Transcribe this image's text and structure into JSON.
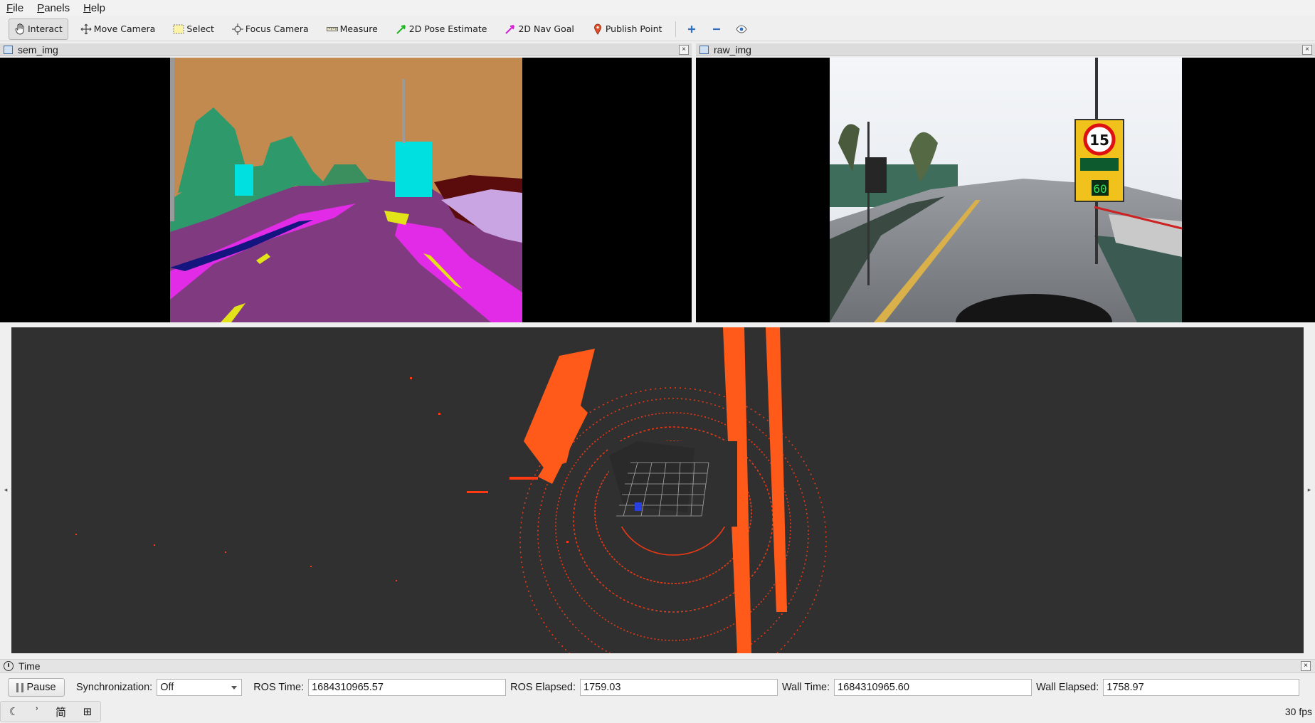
{
  "menubar": {
    "items": [
      {
        "label": "File",
        "mnemonic": "F",
        "rest": "ile"
      },
      {
        "label": "Panels",
        "mnemonic": "P",
        "rest": "anels"
      },
      {
        "label": "Help",
        "mnemonic": "H",
        "rest": "elp"
      }
    ]
  },
  "toolbar": {
    "tools": [
      {
        "label": "Interact",
        "icon": "hand-cursor-icon",
        "active": true
      },
      {
        "label": "Move Camera",
        "icon": "move-camera-icon"
      },
      {
        "label": "Select",
        "icon": "select-box-icon"
      },
      {
        "label": "Focus Camera",
        "icon": "focus-camera-icon"
      },
      {
        "label": "Measure",
        "icon": "ruler-icon"
      },
      {
        "label": "2D Pose Estimate",
        "icon": "green-arrow-icon"
      },
      {
        "label": "2D Nav Goal",
        "icon": "magenta-arrow-icon"
      },
      {
        "label": "Publish Point",
        "icon": "map-pin-icon"
      }
    ],
    "extra_icons": [
      "plus-icon",
      "minus-icon",
      "eye-icon"
    ]
  },
  "panels": {
    "sem_img": {
      "title": "sem_img",
      "close": "×"
    },
    "raw_img": {
      "title": "raw_img",
      "close": "×"
    },
    "raw_sign": {
      "speed": "15",
      "digital": "60"
    }
  },
  "time_panel": {
    "title": "Time",
    "close": "×",
    "pause_label": "Pause",
    "sync_label": "Synchronization:",
    "sync_value": "Off",
    "ros_time_label": "ROS Time:",
    "ros_time_value": "1684310965.57",
    "ros_elapsed_label": "ROS Elapsed:",
    "ros_elapsed_value": "1759.03",
    "wall_time_label": "Wall Time:",
    "wall_time_value": "1684310965.60",
    "wall_elapsed_label": "Wall Elapsed:",
    "wall_elapsed_value": "1758.97"
  },
  "statusbar": {
    "fps": "30 fps",
    "tray_icons": [
      "moon-icon",
      "comma-icon",
      "simplified-chinese-icon",
      "grid-icon"
    ],
    "tray_glyphs": [
      "☾",
      "ʾ",
      "简",
      "⊞"
    ]
  },
  "colors": {
    "semantic_sky": "#c38a4f",
    "semantic_road": "#803b80",
    "semantic_vegetation": "#2e9a6b",
    "semantic_sign": "#00e0e0",
    "semantic_sidewalk": "#e22be6",
    "pointcloud": "#ff3a12",
    "viewport_bg": "#303030"
  }
}
